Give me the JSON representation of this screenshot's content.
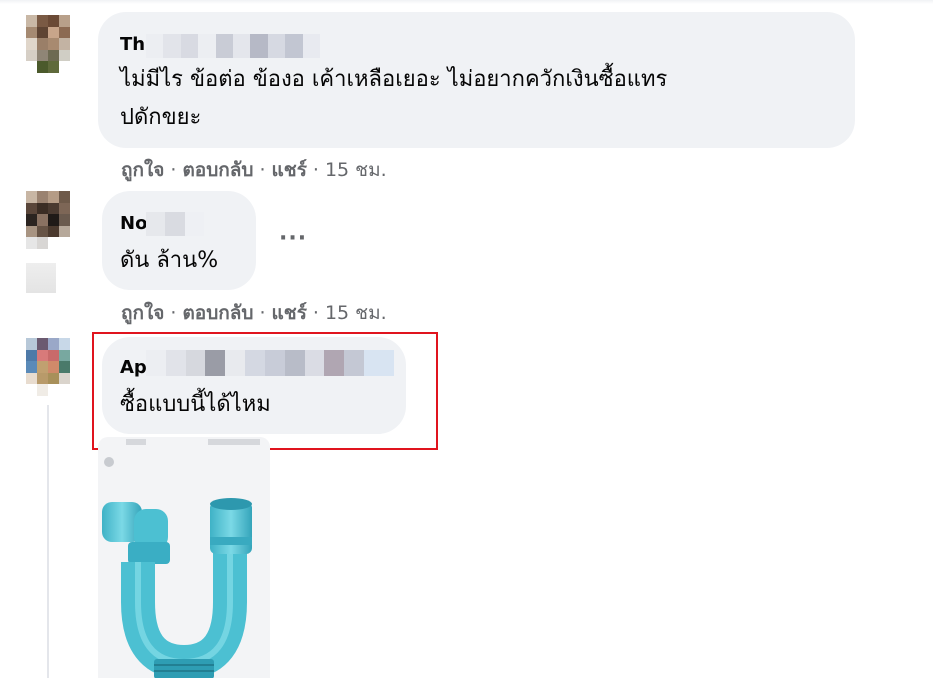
{
  "comments": [
    {
      "author": "Th",
      "text_line1": "ไม่มีไร ข้อต่อ ข้องอ เค้าเหลือเยอะ ไม่อยากควักเงินซื้อแทร",
      "text_line2": "ปดักขยะ",
      "actions": {
        "like": "ถูกใจ",
        "reply": "ตอบกลับ",
        "share": "แชร์",
        "time": "15 ชม."
      }
    },
    {
      "author": "No",
      "text_line1": "ดัน ล้าน%",
      "actions": {
        "like": "ถูกใจ",
        "reply": "ตอบกลับ",
        "share": "แชร์",
        "time": "15 ชม."
      }
    },
    {
      "author": "Ap",
      "text_line1": "ซื้อแบบนี้ได้ไหม"
    }
  ],
  "colors": {
    "bubble": "#f0f2f5",
    "highlight": "#e0141e",
    "meta_text": "#65676b",
    "pipe": "#5bc8d8"
  },
  "icons": {
    "more": "more-options-icon",
    "close": "close-icon"
  },
  "separator": "·"
}
